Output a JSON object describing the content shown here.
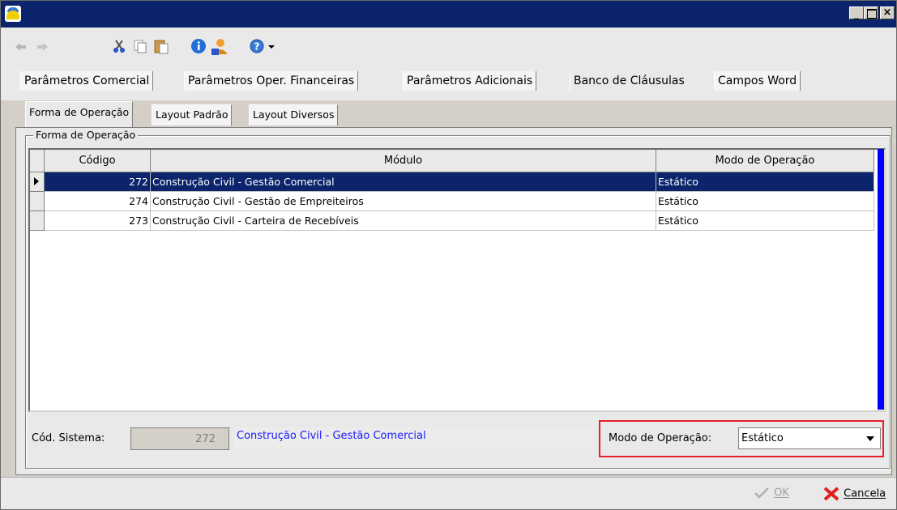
{
  "window": {
    "title": "",
    "controls": [
      "minimize",
      "maximize",
      "close"
    ]
  },
  "toolbar": {
    "icons": [
      "undo-icon",
      "redo-icon",
      "cut-icon",
      "copy-icon",
      "paste-icon",
      "info-icon",
      "user-icon",
      "help-icon",
      "dropdown-arrow-icon"
    ]
  },
  "main_tabs": [
    {
      "label": "Parâmetros Comercial"
    },
    {
      "label": "Parâmetros Oper. Financeiras"
    },
    {
      "label": "Parâmetros Adicionais"
    },
    {
      "label": "Banco de Cláusulas",
      "active": true
    },
    {
      "label": "Campos Word"
    }
  ],
  "sub_tabs": [
    {
      "label": "Forma de Operação",
      "active": true
    },
    {
      "label": "Layout Padrão"
    },
    {
      "label": "Layout Diversos"
    }
  ],
  "group_label": "Forma de Operação",
  "grid": {
    "columns": [
      "Código",
      "Módulo",
      "Modo de Operação"
    ],
    "rows": [
      {
        "codigo": "272",
        "modulo": "Construção Civil - Gestão Comercial",
        "modo": "Estático",
        "selected": true
      },
      {
        "codigo": "274",
        "modulo": "Construção Civil - Gestão de Empreiteiros",
        "modo": "Estático"
      },
      {
        "codigo": "273",
        "modulo": "Construção Civil - Carteira de Recebíveis",
        "modo": "Estático"
      }
    ]
  },
  "details": {
    "cod_sistema_label": "Cód. Sistema:",
    "cod_sistema_value": "272",
    "modulo_value": "Construção Civil - Gestão Comercial",
    "modo_label": "Modo de Operação:",
    "modo_value": "Estático"
  },
  "footer": {
    "ok_label": "OK",
    "cancel_label": "Cancela"
  },
  "colors": {
    "titlebar": "#0b246b",
    "selection": "#0b246b",
    "highlight_box": "#e81e2a",
    "scrollbar": "#0000ff",
    "link_text": "#1a1aff"
  }
}
